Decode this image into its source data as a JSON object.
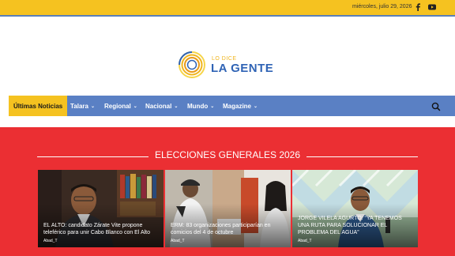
{
  "topbar": {
    "date": "miércoles, julio 29, 2026",
    "social": [
      "facebook-icon",
      "youtube-icon"
    ],
    "color": "#f5c220"
  },
  "logo": {
    "tagline": "LO DICE",
    "name": "LA GENTE"
  },
  "nav": {
    "items": [
      {
        "label": "Últimas Noticias",
        "active": true
      },
      {
        "label": "Talara",
        "dropdown": true
      },
      {
        "label": "Regional",
        "dropdown": true
      },
      {
        "label": "Nacional",
        "dropdown": true
      },
      {
        "label": "Mundo",
        "dropdown": true
      },
      {
        "label": "Magazine",
        "dropdown": true
      }
    ],
    "chevron": "⌄",
    "search_icon": "search-icon",
    "color": "#5a80c4",
    "active_color": "#f5c220"
  },
  "section": {
    "title": "ELECCIONES GENERALES 2026",
    "color": "#eb2f33"
  },
  "articles": [
    {
      "headline": "EL ALTO: candidato Zárate Vite propone teleférico para unir Cabo Blanco con El Alto",
      "author": "Abad_T"
    },
    {
      "headline": "ERM: 83 organizaciones participarían en comicios del 4 de octubre",
      "author": "Abad_T"
    },
    {
      "headline": "JORGE VILELA AGURTO: “YA TENEMOS UNA RUTA PARA SOLUCIONAR EL PROBLEMA DEL AGUA”",
      "author": "Abad_T"
    }
  ]
}
